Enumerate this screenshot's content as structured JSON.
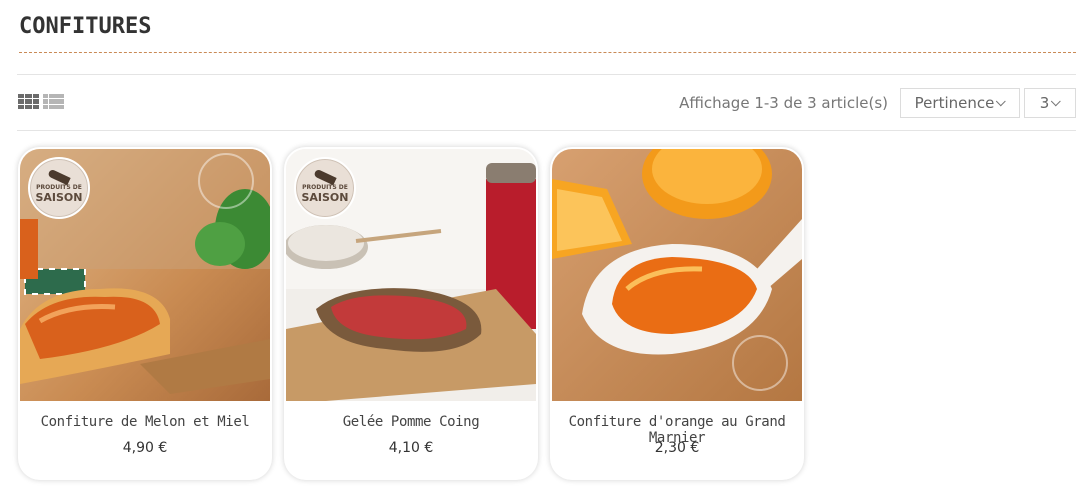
{
  "page": {
    "title": "CONFITURES"
  },
  "toolbar": {
    "view_modes": [
      {
        "name": "grid-view",
        "icon": "grid-icon",
        "active": true
      },
      {
        "name": "list-view",
        "icon": "list-icon",
        "active": false
      }
    ],
    "count_text": "Affichage 1-3 de 3 article(s)",
    "sort": {
      "selected": "Pertinence"
    },
    "per_page": {
      "selected": "3"
    }
  },
  "products": [
    {
      "name": "Confiture de Melon et Miel",
      "price": "4,90 €",
      "badge": {
        "line1": "PRODUITS DE",
        "line2": "SAISON"
      }
    },
    {
      "name": "Gelée Pomme Coing",
      "price": "4,10 €",
      "badge": {
        "line1": "PRODUITS DE",
        "line2": "SAISON"
      }
    },
    {
      "name": "Confiture d'orange au Grand Marnier",
      "price": "2,30 €"
    }
  ],
  "colors": {
    "accent": "#c98a56",
    "title": "#333333"
  }
}
